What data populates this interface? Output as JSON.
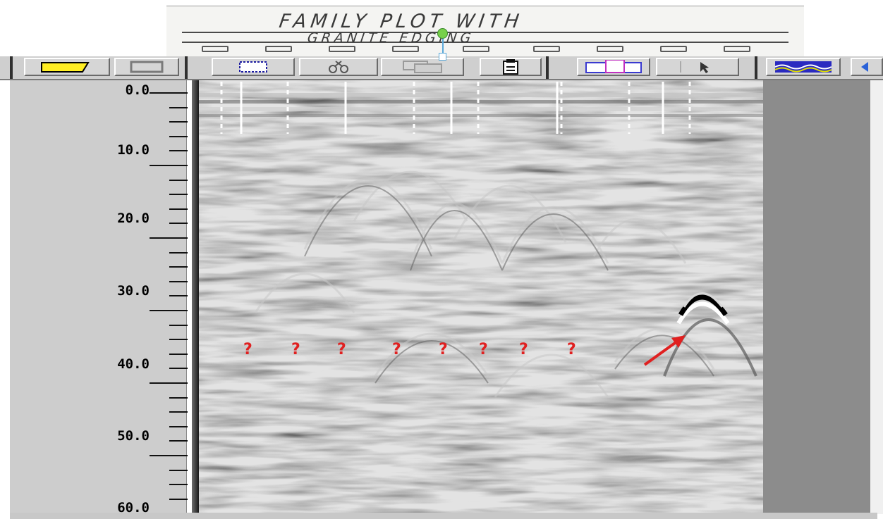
{
  "caption": {
    "line1": "FAMILY PLOT WITH",
    "line2": "GRANITE EDGING"
  },
  "toolbar": {
    "buttons": [
      {
        "name": "open-folder-button",
        "icon": "folder-icon"
      },
      {
        "name": "grid-button",
        "icon": "frame-icon"
      },
      {
        "name": "select-button",
        "icon": "select-rect-icon"
      },
      {
        "name": "cut-button",
        "icon": "scissors-icon"
      },
      {
        "name": "copy-button",
        "icon": "copy-icon"
      },
      {
        "name": "paste-button",
        "icon": "clipboard-icon"
      },
      {
        "name": "paste-special-button",
        "icon": "clipboard-color-icon"
      },
      {
        "name": "pointer-button",
        "icon": "pointer-icon"
      },
      {
        "name": "color-scale-button",
        "icon": "waves-icon"
      },
      {
        "name": "arrow-button",
        "icon": "left-arrow-icon"
      }
    ]
  },
  "depth_scale": {
    "labels": [
      "0.0",
      "10.0",
      "20.0",
      "30.0",
      "40.0",
      "50.0",
      "60.0"
    ]
  },
  "annotations": {
    "question_marks": [
      "?",
      "?",
      "?",
      "?",
      "?",
      "?",
      "?",
      "?"
    ],
    "arrow_color": "#e02020"
  },
  "colors": {
    "radargram_background": "#8f8f8f",
    "marker_color": "#ffffff",
    "annotation_color": "#e02020"
  }
}
